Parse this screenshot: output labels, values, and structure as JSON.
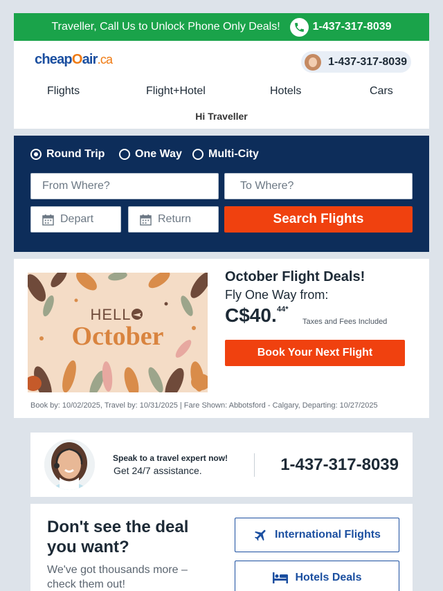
{
  "topbar": {
    "message": "Traveller, Call Us to Unlock Phone Only Deals!",
    "phone": "1-437-317-8039"
  },
  "header": {
    "logo": {
      "part1": "cheap",
      "part2": "O",
      "part3": "air",
      "part4": ".ca"
    },
    "phone": "1-437-317-8039",
    "nav": [
      "Flights",
      "Flight+Hotel",
      "Hotels",
      "Cars"
    ],
    "greeting": "Hi Traveller"
  },
  "search": {
    "trip_types": [
      "Round Trip",
      "One Way",
      "Multi-City"
    ],
    "selected_trip": "Round Trip",
    "from_placeholder": "From Where?",
    "to_placeholder": "To Where?",
    "depart_placeholder": "Depart",
    "return_placeholder": "Return",
    "button": "Search Flights"
  },
  "deal": {
    "image_text1": "HELL",
    "image_text2": "October",
    "title": "October Flight Deals!",
    "subtitle": "Fly One Way from:",
    "price": "C$40.",
    "cents": "44*",
    "tax_note": "Taxes and Fees Included",
    "button": "Book Your Next Flight",
    "fine_print": "Book by: 10/02/2025, Travel by: 10/31/2025  | Fare Shown: Abbotsford - Calgary, Departing: 10/27/2025"
  },
  "expert": {
    "line1": "Speak to a travel expert now!",
    "line2": "Get 24/7 assistance.",
    "phone": "1-437-317-8039"
  },
  "more": {
    "heading": "Don't see the deal you want?",
    "text": "We've got thousands more – check them out!",
    "links": [
      "International Flights",
      "Hotels Deals"
    ]
  },
  "colors": {
    "green": "#1aa34a",
    "navy": "#0d2d5a",
    "orange": "#f0410f",
    "link_blue": "#1b4fa0"
  }
}
